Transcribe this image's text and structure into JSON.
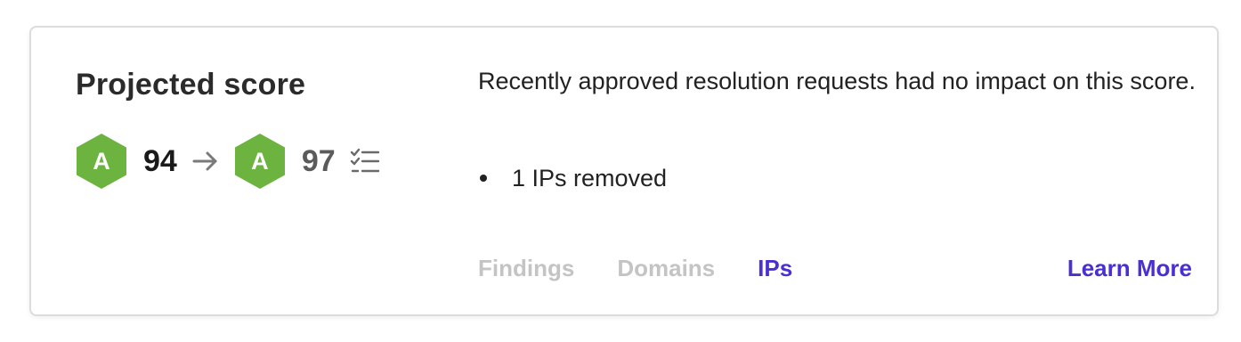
{
  "card": {
    "title": "Projected score",
    "current": {
      "grade": "A",
      "score": "94"
    },
    "projected": {
      "grade": "A",
      "score": "97"
    },
    "message": "Recently approved resolution requests had no impact on this score.",
    "changes": [
      {
        "text": "1 IPs removed"
      }
    ],
    "tabs": [
      {
        "label": "Findings",
        "active": false
      },
      {
        "label": "Domains",
        "active": false
      },
      {
        "label": "IPs",
        "active": true
      }
    ],
    "learn_more_label": "Learn More"
  },
  "colors": {
    "grade_green": "#6cb33f",
    "accent": "#4a2fd1",
    "inactive_tab": "#c4c4c4",
    "border": "#dcdcdc"
  },
  "icons": {
    "arrow": "arrow-right-icon",
    "checklist": "checklist-icon"
  }
}
